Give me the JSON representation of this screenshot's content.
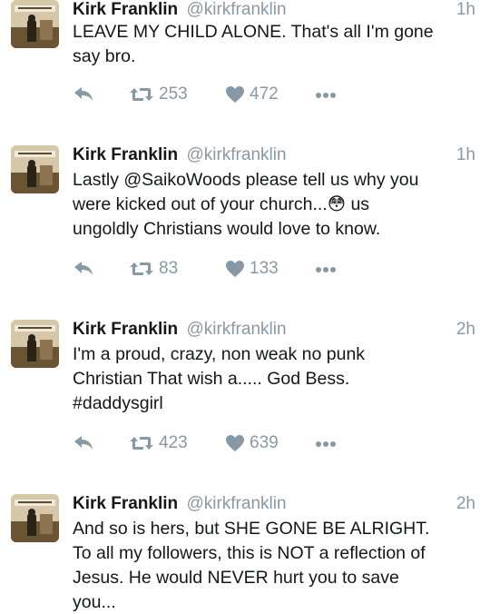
{
  "tweets": [
    {
      "name": "Kirk Franklin",
      "handle": "@kirkfranklin",
      "time": "1h",
      "text": "LEAVE MY CHILD ALONE. That's all I'm gone\nsay bro.",
      "retweets": "253",
      "likes": "472"
    },
    {
      "name": "Kirk Franklin",
      "handle": "@kirkfranklin",
      "time": "1h",
      "text": "Lastly @SaikoWoods please tell us why you\nwere kicked out of your church...😳 us\nungoldly Christians would love to know.",
      "retweets": "83",
      "likes": "133"
    },
    {
      "name": "Kirk Franklin",
      "handle": "@kirkfranklin",
      "time": "2h",
      "text": "I'm a proud, crazy, non weak no punk\nChristian That wish a..... God Bess.\n#daddysgirl",
      "retweets": "423",
      "likes": "639"
    },
    {
      "name": "Kirk Franklin",
      "handle": "@kirkfranklin",
      "time": "2h",
      "text": "And so is hers, but SHE GONE BE ALRIGHT.\nTo all my followers, this is NOT a reflection of\nJesus. He would NEVER hurt you to save\nyou...",
      "retweets": "",
      "likes": ""
    }
  ],
  "colors": {
    "text": "#14171a",
    "muted": "#8899a6",
    "divider": "#e1e8ed"
  },
  "icons": {
    "reply": "reply-icon",
    "retweet": "retweet-icon",
    "like": "heart-icon",
    "more": "more-icon"
  }
}
